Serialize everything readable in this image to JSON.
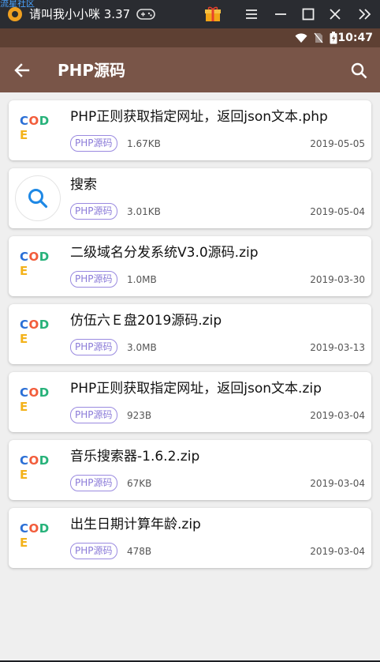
{
  "emulator": {
    "watermark": "流星社区",
    "title": "请叫我小小咪 3.37",
    "icons": [
      "gamepad-icon",
      "gift-icon",
      "menu-icon",
      "minimize-icon",
      "maximize-icon",
      "close-icon",
      "collapse-icon"
    ]
  },
  "status_bar": {
    "time": "10:47"
  },
  "app_bar": {
    "title": "PHP源码"
  },
  "logo_letters": [
    "C",
    "O",
    "D",
    "E"
  ],
  "logo_colors": [
    "#2b6fd6",
    "#f25c3b",
    "#27b27a",
    "#f3b21b"
  ],
  "files": [
    {
      "title": "PHP正则获取指定网址，返回json文本.php",
      "tag": "PHP源码",
      "size": "1.67KB",
      "date": "2019-05-05",
      "thumb": "code"
    },
    {
      "title": "搜索",
      "tag": "PHP源码",
      "size": "3.01KB",
      "date": "2019-05-04",
      "thumb": "search"
    },
    {
      "title": "二级域名分发系统V3.0源码.zip",
      "tag": "PHP源码",
      "size": "1.0MB",
      "date": "2019-03-30",
      "thumb": "code"
    },
    {
      "title": "仿伍六Ｅ盘2019源码.zip",
      "tag": "PHP源码",
      "size": "3.0MB",
      "date": "2019-03-13",
      "thumb": "code"
    },
    {
      "title": "PHP正则获取指定网址，返回json文本.zip",
      "tag": "PHP源码",
      "size": "923B",
      "date": "2019-03-04",
      "thumb": "code"
    },
    {
      "title": "音乐搜索器-1.6.2.zip",
      "tag": "PHP源码",
      "size": "67KB",
      "date": "2019-03-04",
      "thumb": "code"
    },
    {
      "title": "出生日期计算年龄.zip",
      "tag": "PHP源码",
      "size": "478B",
      "date": "2019-03-04",
      "thumb": "code"
    }
  ]
}
